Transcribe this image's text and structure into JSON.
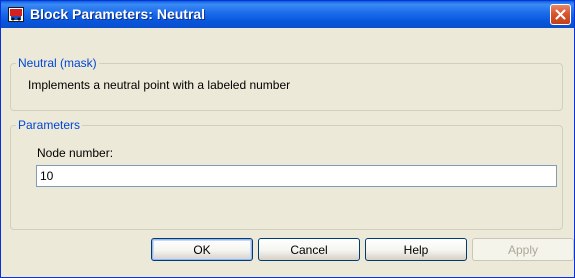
{
  "window": {
    "title": "Block Parameters: Neutral"
  },
  "mask_group": {
    "title": "Neutral (mask)",
    "description": "Implements a neutral point with a labeled number"
  },
  "params_group": {
    "title": "Parameters",
    "node_label": "Node number:",
    "node_value": "10"
  },
  "buttons": {
    "ok": "OK",
    "cancel": "Cancel",
    "help": "Help",
    "apply": "Apply"
  },
  "icons": {
    "app": "simulink-block-icon",
    "close": "close-icon"
  },
  "colors": {
    "titlebar": "#0a5fde",
    "group_title": "#0046d5",
    "close_button": "#d9562f",
    "dialog_bg": "#ece9d8"
  }
}
